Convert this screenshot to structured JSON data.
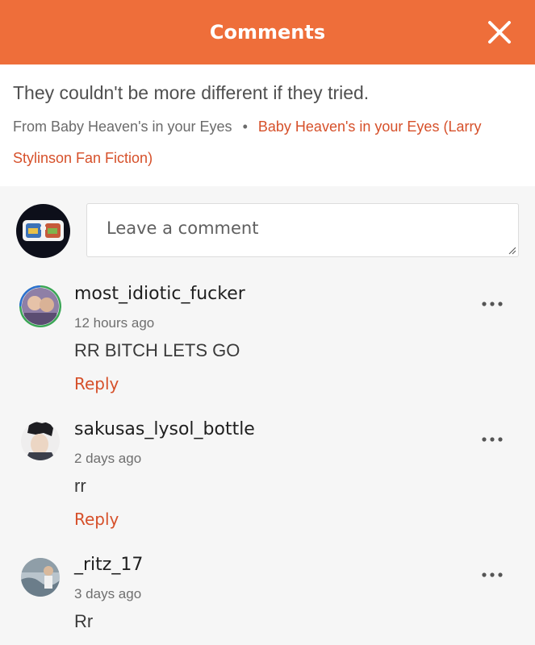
{
  "header": {
    "title": "Comments",
    "close_icon": "close-icon"
  },
  "context": {
    "quote": "They couldn't be more different if they tried.",
    "source_prefix": "From Baby Heaven's in your Eyes",
    "separator": "•",
    "story_link": "Baby Heaven's in your Eyes (Larry Stylinson Fan Fiction)"
  },
  "compose": {
    "placeholder": "Leave a comment"
  },
  "comments": [
    {
      "username": "most_idiotic_fucker",
      "time": "12 hours ago",
      "text": "RR BITCH LETS GO",
      "reply": "Reply"
    },
    {
      "username": "sakusas_lysol_bottle",
      "time": "2 days ago",
      "text": "rr",
      "reply": "Reply"
    },
    {
      "username": "_ritz_17",
      "time": "3 days ago",
      "text": "Rr"
    }
  ],
  "colors": {
    "accent": "#ee6e3a",
    "link": "#d6502a"
  }
}
